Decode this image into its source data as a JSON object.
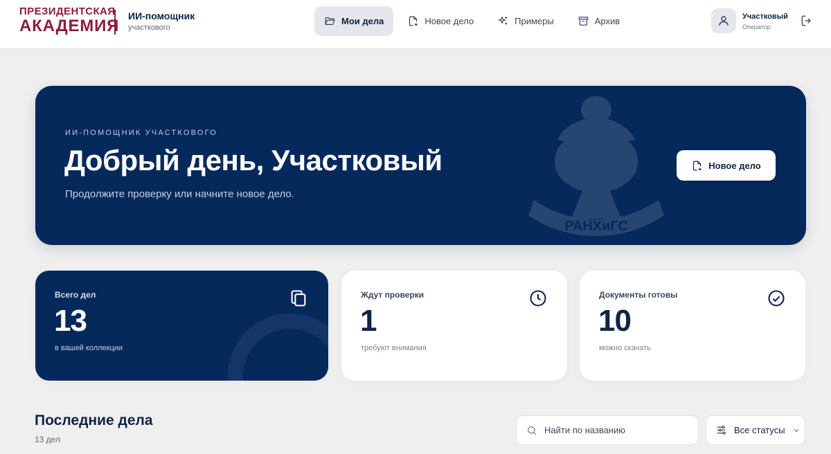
{
  "header": {
    "logo": {
      "line1": "ПРЕЗИДЕНТСКАЯ",
      "line2": "АКАДЕМИЯ"
    },
    "app_title": "ИИ-помощник",
    "app_subtitle": "участкового",
    "nav": [
      {
        "label": "Мои дела",
        "icon": "folder-open-icon",
        "active": true
      },
      {
        "label": "Новое дело",
        "icon": "file-plus-icon",
        "active": false
      },
      {
        "label": "Примеры",
        "icon": "sparkles-icon",
        "active": false
      },
      {
        "label": "Архив",
        "icon": "archive-icon",
        "active": false
      }
    ],
    "user": {
      "name": "Участковый",
      "role": "Оператор",
      "avatar_icon": "user-icon"
    },
    "logout_icon": "logout-icon"
  },
  "hero": {
    "eyebrow": "ИИ-ПОМОЩНИК УЧАСТКОВОГО",
    "title": "Добрый день, Участковый",
    "subtitle": "Продолжите проверку или начните новое дело.",
    "button_label": "Новое дело",
    "emblem_text": "РАНХиГС"
  },
  "stats": [
    {
      "label": "Всего дел",
      "value": "13",
      "note": "в вашей коллекции",
      "icon": "copy-icon"
    },
    {
      "label": "Ждут проверки",
      "value": "1",
      "note": "требуют внимания",
      "icon": "clock-icon"
    },
    {
      "label": "Документы готовы",
      "value": "10",
      "note": "можно скачать",
      "icon": "check-circle-icon"
    }
  ],
  "recent": {
    "title": "Последние дела",
    "count": "13 дел",
    "search_placeholder": "Найти по названию",
    "status_filter": "Все статусы"
  },
  "colors": {
    "brand": "#8b1d3b",
    "primary": "#06295c",
    "background": "#efefef",
    "surface": "#ffffff"
  }
}
